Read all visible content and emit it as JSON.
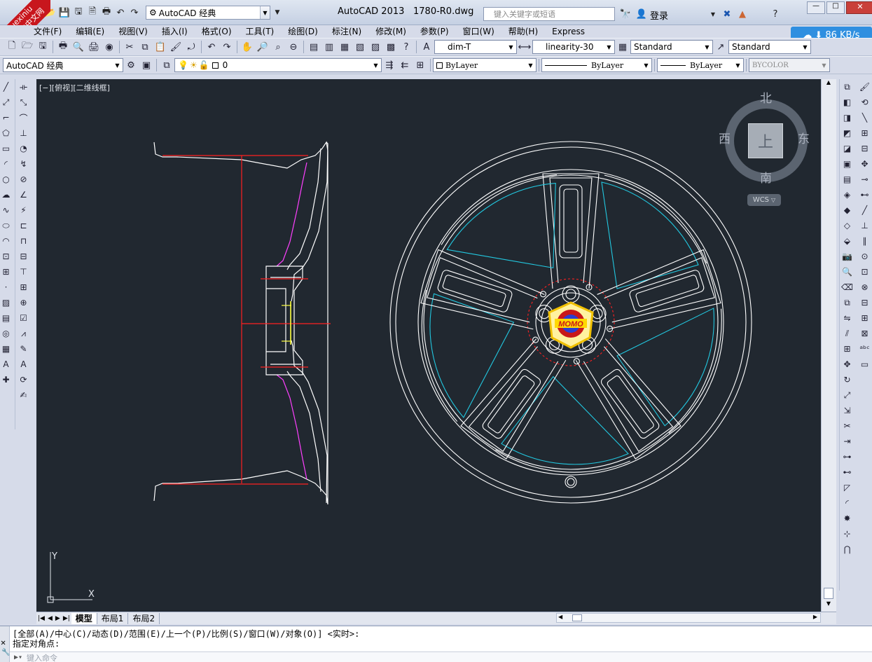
{
  "watermark": {
    "line1": "xuexiniu",
    "line2": "学犀牛中文网"
  },
  "title": {
    "workspace": "AutoCAD 经典",
    "app": "AutoCAD 2013",
    "file": "1780-R0.dwg",
    "search_placeholder": "键入关键字或短语",
    "login": "登录"
  },
  "menu": [
    "文件(F)",
    "编辑(E)",
    "视图(V)",
    "插入(I)",
    "格式(O)",
    "工具(T)",
    "绘图(D)",
    "标注(N)",
    "修改(M)",
    "参数(P)",
    "窗口(W)",
    "帮助(H)",
    "Express"
  ],
  "speed": "86 KB/s",
  "styles": {
    "text_style": "dim-T",
    "dim_style": "linearity-30",
    "table_style": "Standard",
    "multileader_style": "Standard"
  },
  "layers": {
    "workspace": "AutoCAD 经典",
    "layer": "0",
    "color": "ByLayer",
    "linetype": "ByLayer",
    "lineweight": "ByLayer",
    "plot": "BYCOLOR"
  },
  "viewport_label": "[−][俯视][二维线框]",
  "viewcube": {
    "north": "北",
    "south": "南",
    "west": "西",
    "east": "东",
    "face": "上",
    "wcs": "WCS"
  },
  "ucs": {
    "x": "X",
    "y": "Y"
  },
  "logo_text": "MOMO",
  "tabs": [
    "模型",
    "布局1",
    "布局2"
  ],
  "command": {
    "line1": "[全部(A)/中心(C)/动态(D)/范围(E)/上一个(P)/比例(S)/窗口(W)/对象(O)] <实时>:",
    "line2": "指定对角点:",
    "placeholder": "键入命令"
  }
}
